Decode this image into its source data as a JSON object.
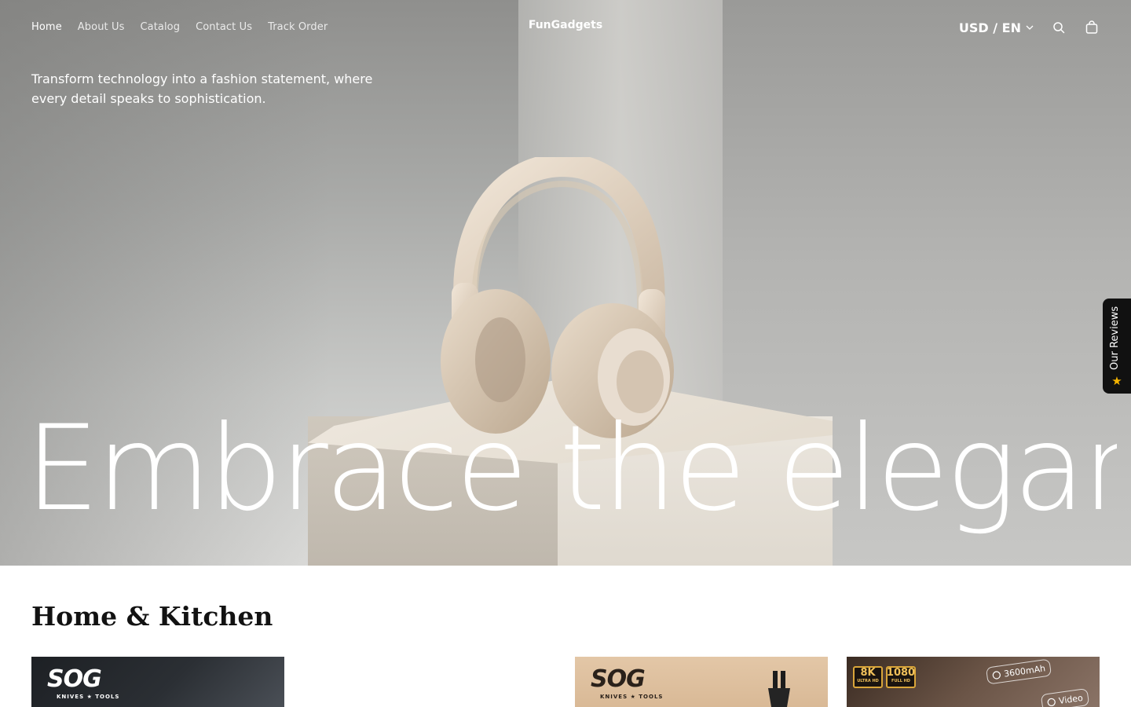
{
  "header": {
    "nav": [
      {
        "label": "Home",
        "active": true
      },
      {
        "label": "About Us",
        "active": false
      },
      {
        "label": "Catalog",
        "active": false
      },
      {
        "label": "Contact Us",
        "active": false
      },
      {
        "label": "Track Order",
        "active": false
      }
    ],
    "brand": "FunGadgets",
    "currency_language": "USD / EN",
    "icons": [
      "chevron-down-icon",
      "search-icon",
      "shopping-bag-icon"
    ]
  },
  "hero": {
    "tagline": "Transform technology into a fashion statement, where every detail speaks to sophistication.",
    "headline": "Embrace the elegance"
  },
  "reviews_tab": {
    "label": "Our Reviews",
    "icon": "star-icon",
    "colors": {
      "background": "#111111",
      "star": "#f5b400"
    }
  },
  "collection": {
    "title": "Home & Kitchen",
    "cards": [
      {
        "logo": "SOG",
        "logo_sub": "KNIVES ★ TOOLS"
      },
      {
        "logo": "SOG",
        "logo_sub": "KNIVES ★ TOOLS"
      },
      {
        "badges": [
          {
            "big": "8K",
            "small": "ULTRA HD"
          },
          {
            "big": "1080",
            "small": "FULL HD"
          }
        ],
        "pills": [
          "3600mAh",
          "Video"
        ]
      }
    ]
  }
}
